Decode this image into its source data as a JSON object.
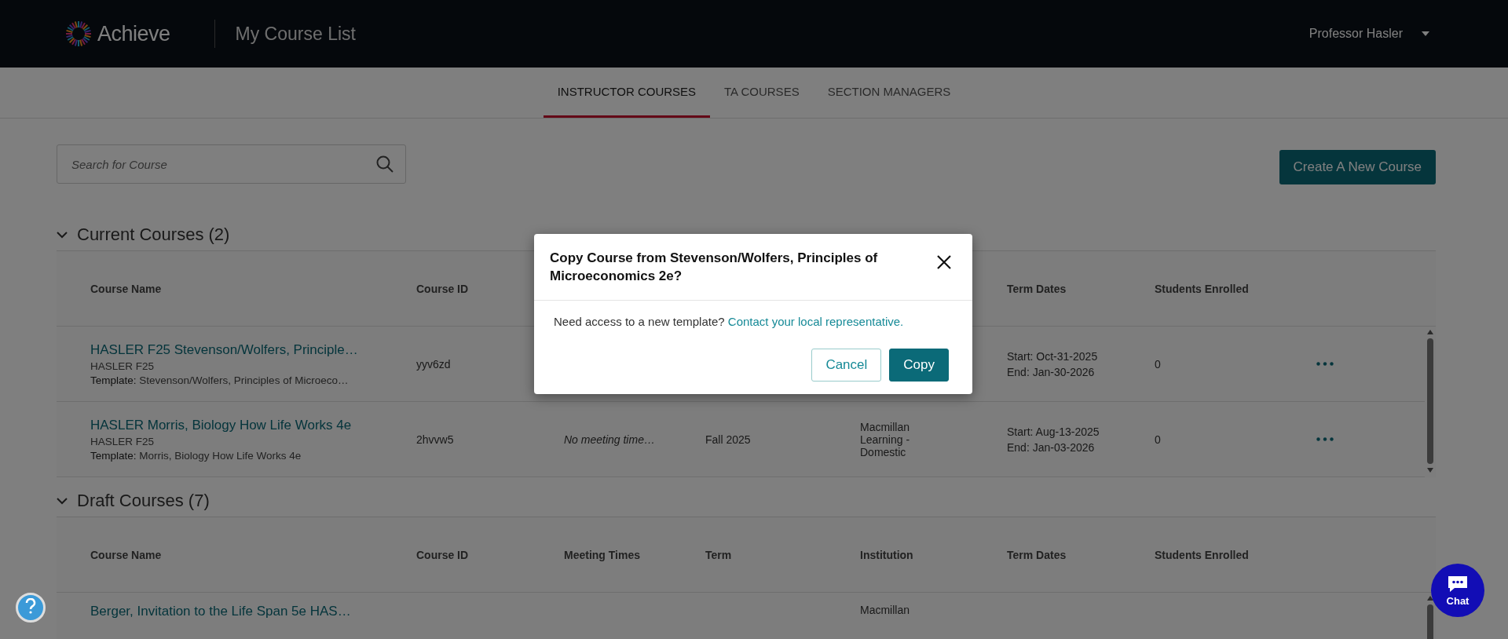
{
  "header": {
    "logo": "Achieve",
    "page_title": "My Course List",
    "user": "Professor Hasler"
  },
  "tabs": [
    {
      "label": "INSTRUCTOR COURSES",
      "selected": true
    },
    {
      "label": "TA COURSES",
      "selected": false
    },
    {
      "label": "SECTION MANAGERS",
      "selected": false
    }
  ],
  "search": {
    "placeholder": "Search for Course"
  },
  "create_button": "Create A New Course",
  "sections": [
    {
      "title": "Current Courses (2)",
      "expanded": true,
      "columns": [
        {
          "label": "Course Name",
          "kind": "name"
        },
        {
          "label": "Course ID",
          "kind": "id"
        },
        {
          "label": "Term Dates",
          "kind": "dates"
        },
        {
          "label": "Students Enrolled",
          "kind": "students"
        }
      ],
      "rows": [
        {
          "name": "HASLER F25 Stevenson/Wolfers, Principle…",
          "section": "HASLER F25",
          "template_label": "Template:",
          "template": "Stevenson/Wolfers, Principles of Microeco…",
          "course_id": "yyv6zd",
          "term_dates": [
            "Start: Oct-31-2025",
            "End: Jan-30-2026"
          ],
          "students": "0",
          "has_actions": true
        },
        {
          "name": "HASLER Morris, Biology How Life Works 4e",
          "section": "HASLER F25",
          "template_label": "Template:",
          "template": "Morris, Biology How Life Works 4e",
          "course_id": "2hvvw5",
          "meeting_times": "No meeting time…",
          "term": "Fall 2025",
          "institution": "Macmillan Learning - Domestic",
          "term_dates": [
            "Start: Aug-13-2025",
            "End: Jan-03-2026"
          ],
          "students": "0",
          "has_actions": true
        }
      ]
    },
    {
      "title": "Draft Courses (7)",
      "expanded": true,
      "columns": [
        {
          "label": "Course Name",
          "kind": "name"
        },
        {
          "label": "Course ID",
          "kind": "id"
        },
        {
          "label": "Meeting Times",
          "kind": "meeting"
        },
        {
          "label": "Term",
          "kind": "term"
        },
        {
          "label": "Institution",
          "kind": "institution"
        },
        {
          "label": "Term Dates",
          "kind": "dates"
        },
        {
          "label": "Students Enrolled",
          "kind": "students"
        }
      ],
      "rows": [
        {
          "name": "Berger, Invitation to the Life Span 5e HAS…",
          "institution": "Macmillan",
          "has_actions": false
        }
      ]
    }
  ],
  "dialog": {
    "title": "Copy Course from Stevenson/Wolfers, Principles of Microeconomics 2e?",
    "text": "Need access to a new template?",
    "link": "Contact your local representative.",
    "buttons": [
      {
        "label": "Cancel",
        "kind": "secondary"
      },
      {
        "label": "Copy",
        "kind": "primary"
      }
    ]
  },
  "chat": {
    "label": "Chat"
  }
}
